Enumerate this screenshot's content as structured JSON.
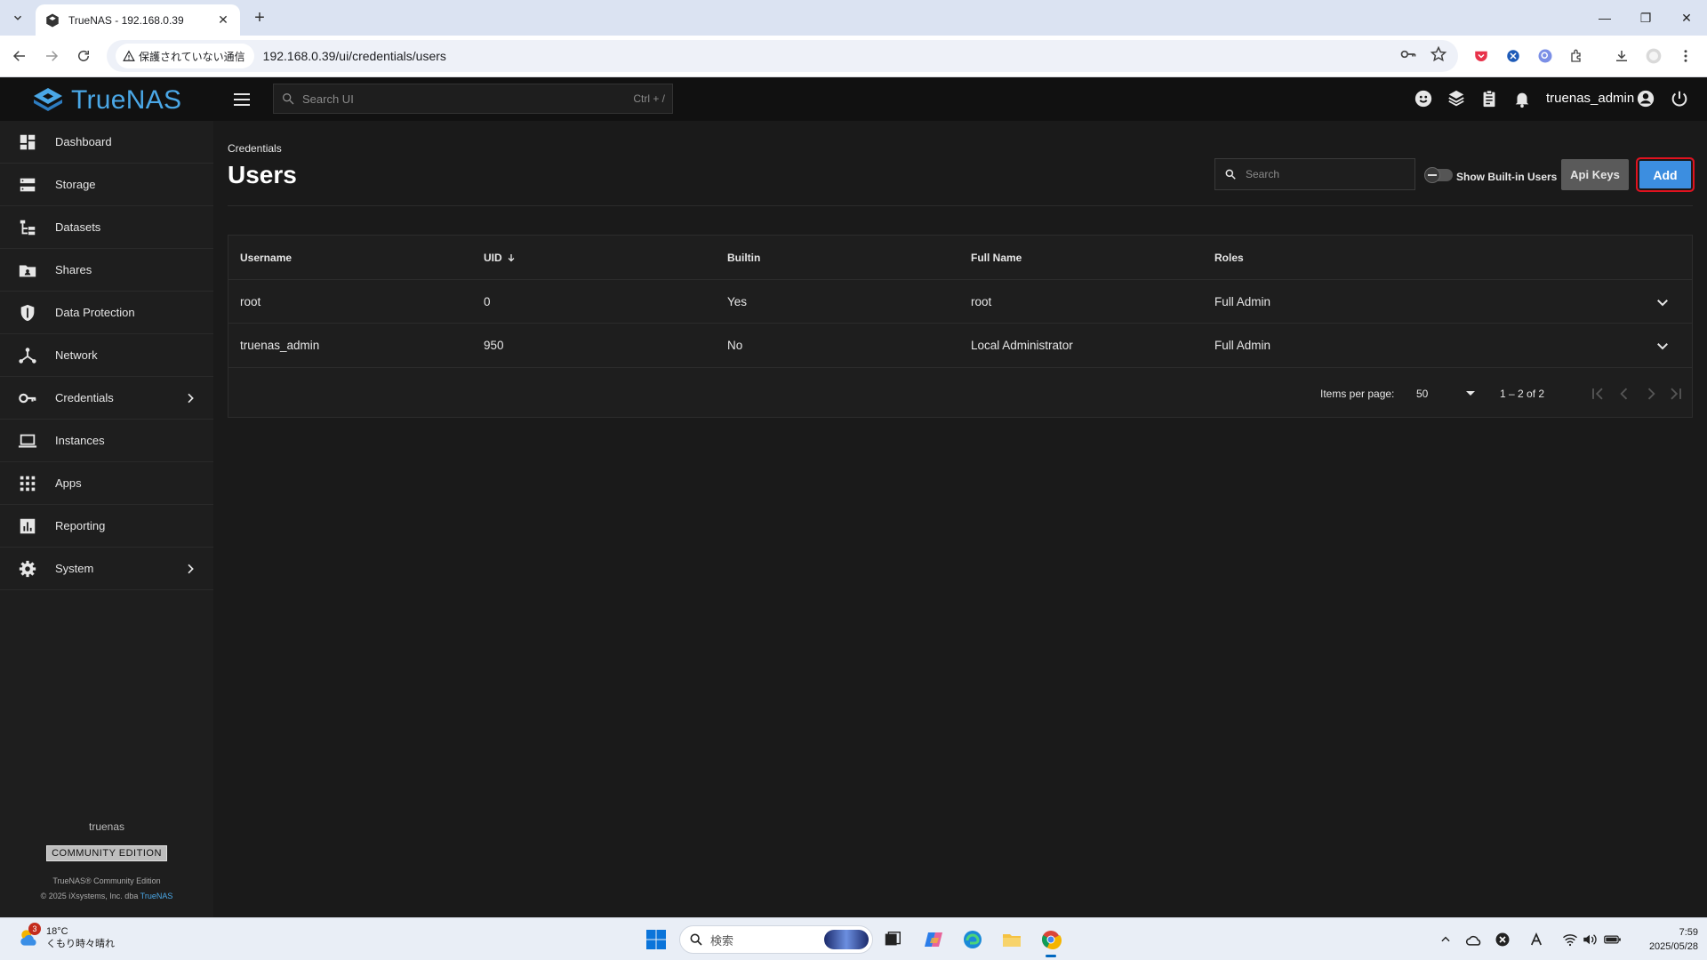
{
  "browser": {
    "tab_title": "TrueNAS - 192.168.0.39",
    "security_label": "保護されていない通信",
    "url": "192.168.0.39/ui/credentials/users"
  },
  "header": {
    "logo_text": "TrueNAS",
    "search_placeholder": "Search UI",
    "search_shortcut": "Ctrl + /",
    "username": "truenas_admin"
  },
  "sidebar": {
    "items": [
      {
        "label": "Dashboard",
        "icon": "dashboard-icon"
      },
      {
        "label": "Storage",
        "icon": "storage-icon"
      },
      {
        "label": "Datasets",
        "icon": "datasets-icon"
      },
      {
        "label": "Shares",
        "icon": "shares-icon"
      },
      {
        "label": "Data Protection",
        "icon": "shield-icon"
      },
      {
        "label": "Network",
        "icon": "network-icon"
      },
      {
        "label": "Credentials",
        "icon": "key-icon",
        "has_children": true
      },
      {
        "label": "Instances",
        "icon": "laptop-icon"
      },
      {
        "label": "Apps",
        "icon": "apps-grid-icon"
      },
      {
        "label": "Reporting",
        "icon": "bar-chart-icon"
      },
      {
        "label": "System",
        "icon": "gear-icon",
        "has_children": true
      }
    ],
    "hostname": "truenas",
    "edition": "COMMUNITY EDITION",
    "copyright_line1": "TrueNAS® Community Edition",
    "copyright_line2": "© 2025 iXsystems, Inc. dba",
    "copyright_link": "TrueNAS"
  },
  "page": {
    "breadcrumb": "Credentials",
    "title": "Users",
    "search_placeholder": "Search",
    "toggle_label": "Show Built-in Users",
    "api_keys_button": "Api Keys",
    "add_button": "Add"
  },
  "table": {
    "columns": [
      "Username",
      "UID",
      "Builtin",
      "Full Name",
      "Roles"
    ],
    "rows": [
      {
        "username": "root",
        "uid": "0",
        "builtin": "Yes",
        "full_name": "root",
        "roles": "Full Admin"
      },
      {
        "username": "truenas_admin",
        "uid": "950",
        "builtin": "No",
        "full_name": "Local Administrator",
        "roles": "Full Admin"
      }
    ],
    "paginator": {
      "items_per_page_label": "Items per page:",
      "items_per_page": "50",
      "range": "1 – 2 of 2"
    }
  },
  "taskbar": {
    "weather_badge": "3",
    "temperature": "18°C",
    "weather_desc": "くもり時々晴れ",
    "search_text": "検索",
    "time": "7:59",
    "date": "2025/05/28"
  },
  "colors": {
    "accent": "#3c8ee0",
    "brand": "#4aa7e6",
    "highlight_border": "#e0121f"
  }
}
